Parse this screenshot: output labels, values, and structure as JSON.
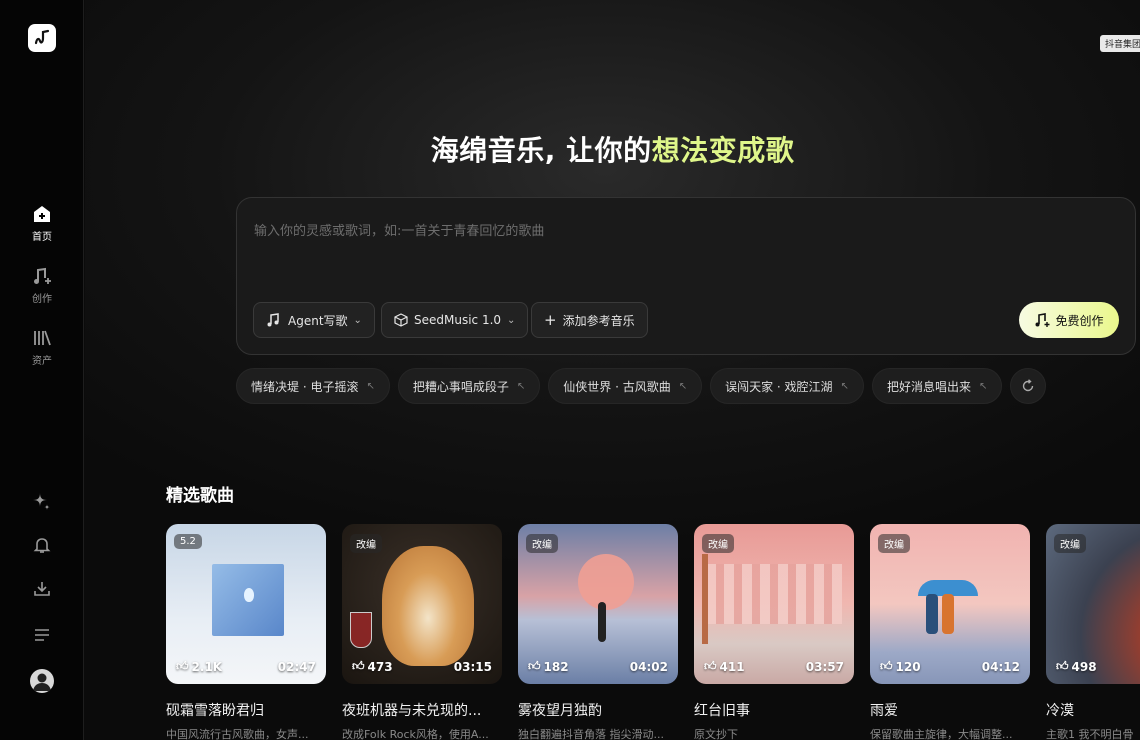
{
  "sidebar": {
    "nav": [
      {
        "label": "首页",
        "icon": "home-plus-icon",
        "active": true
      },
      {
        "label": "创作",
        "icon": "music-note-plus-icon",
        "active": false
      },
      {
        "label": "资产",
        "icon": "library-icon",
        "active": false
      }
    ],
    "bottom_icons": [
      "sparkle-icon",
      "bell-icon",
      "download-icon",
      "menu-lines-icon",
      "user-avatar-icon"
    ]
  },
  "header": {
    "brand_tag": "抖音集团"
  },
  "hero": {
    "title_prefix": "海绵音乐, 让你的",
    "title_highlight": "想法变成歌"
  },
  "prompt": {
    "placeholder": "输入你的灵感或歌词，如:一首关于青春回忆的歌曲",
    "agent_button": "Agent写歌",
    "model_button": "SeedMusic 1.0",
    "ref_button": "添加参考音乐",
    "create_button": "免费创作"
  },
  "chips": [
    "情绪决堤 · 电子摇滚",
    "把糟心事唱成段子",
    "仙侠世界 · 古风歌曲",
    "误闯天家 · 戏腔江湖",
    "把好消息唱出来"
  ],
  "section_title": "精选歌曲",
  "songs": [
    {
      "tag": "5.2",
      "likes": "2.1K",
      "duration": "02:47",
      "title": "砚霜雪落盼君归",
      "desc": "中国风流行古风歌曲，女声..."
    },
    {
      "tag": "改编",
      "likes": "473",
      "duration": "03:15",
      "title": "夜班机器与未兑现的...",
      "desc": "改成Folk Rock风格，使用A..."
    },
    {
      "tag": "改编",
      "likes": "182",
      "duration": "04:02",
      "title": "雾夜望月独酌",
      "desc": "独白翻遍抖音角落 指尖滑动..."
    },
    {
      "tag": "改编",
      "likes": "411",
      "duration": "03:57",
      "title": "红台旧事",
      "desc": "原文抄下"
    },
    {
      "tag": "改编",
      "likes": "120",
      "duration": "04:12",
      "title": "雨爱",
      "desc": "保留歌曲主旋律，大幅调整..."
    },
    {
      "tag": "改编",
      "likes": "498",
      "duration": "",
      "title": "冷漠",
      "desc": "主歌1 我不明白骨"
    }
  ],
  "colors": {
    "accent": "#dff68a",
    "background": "#0b0b0b"
  }
}
